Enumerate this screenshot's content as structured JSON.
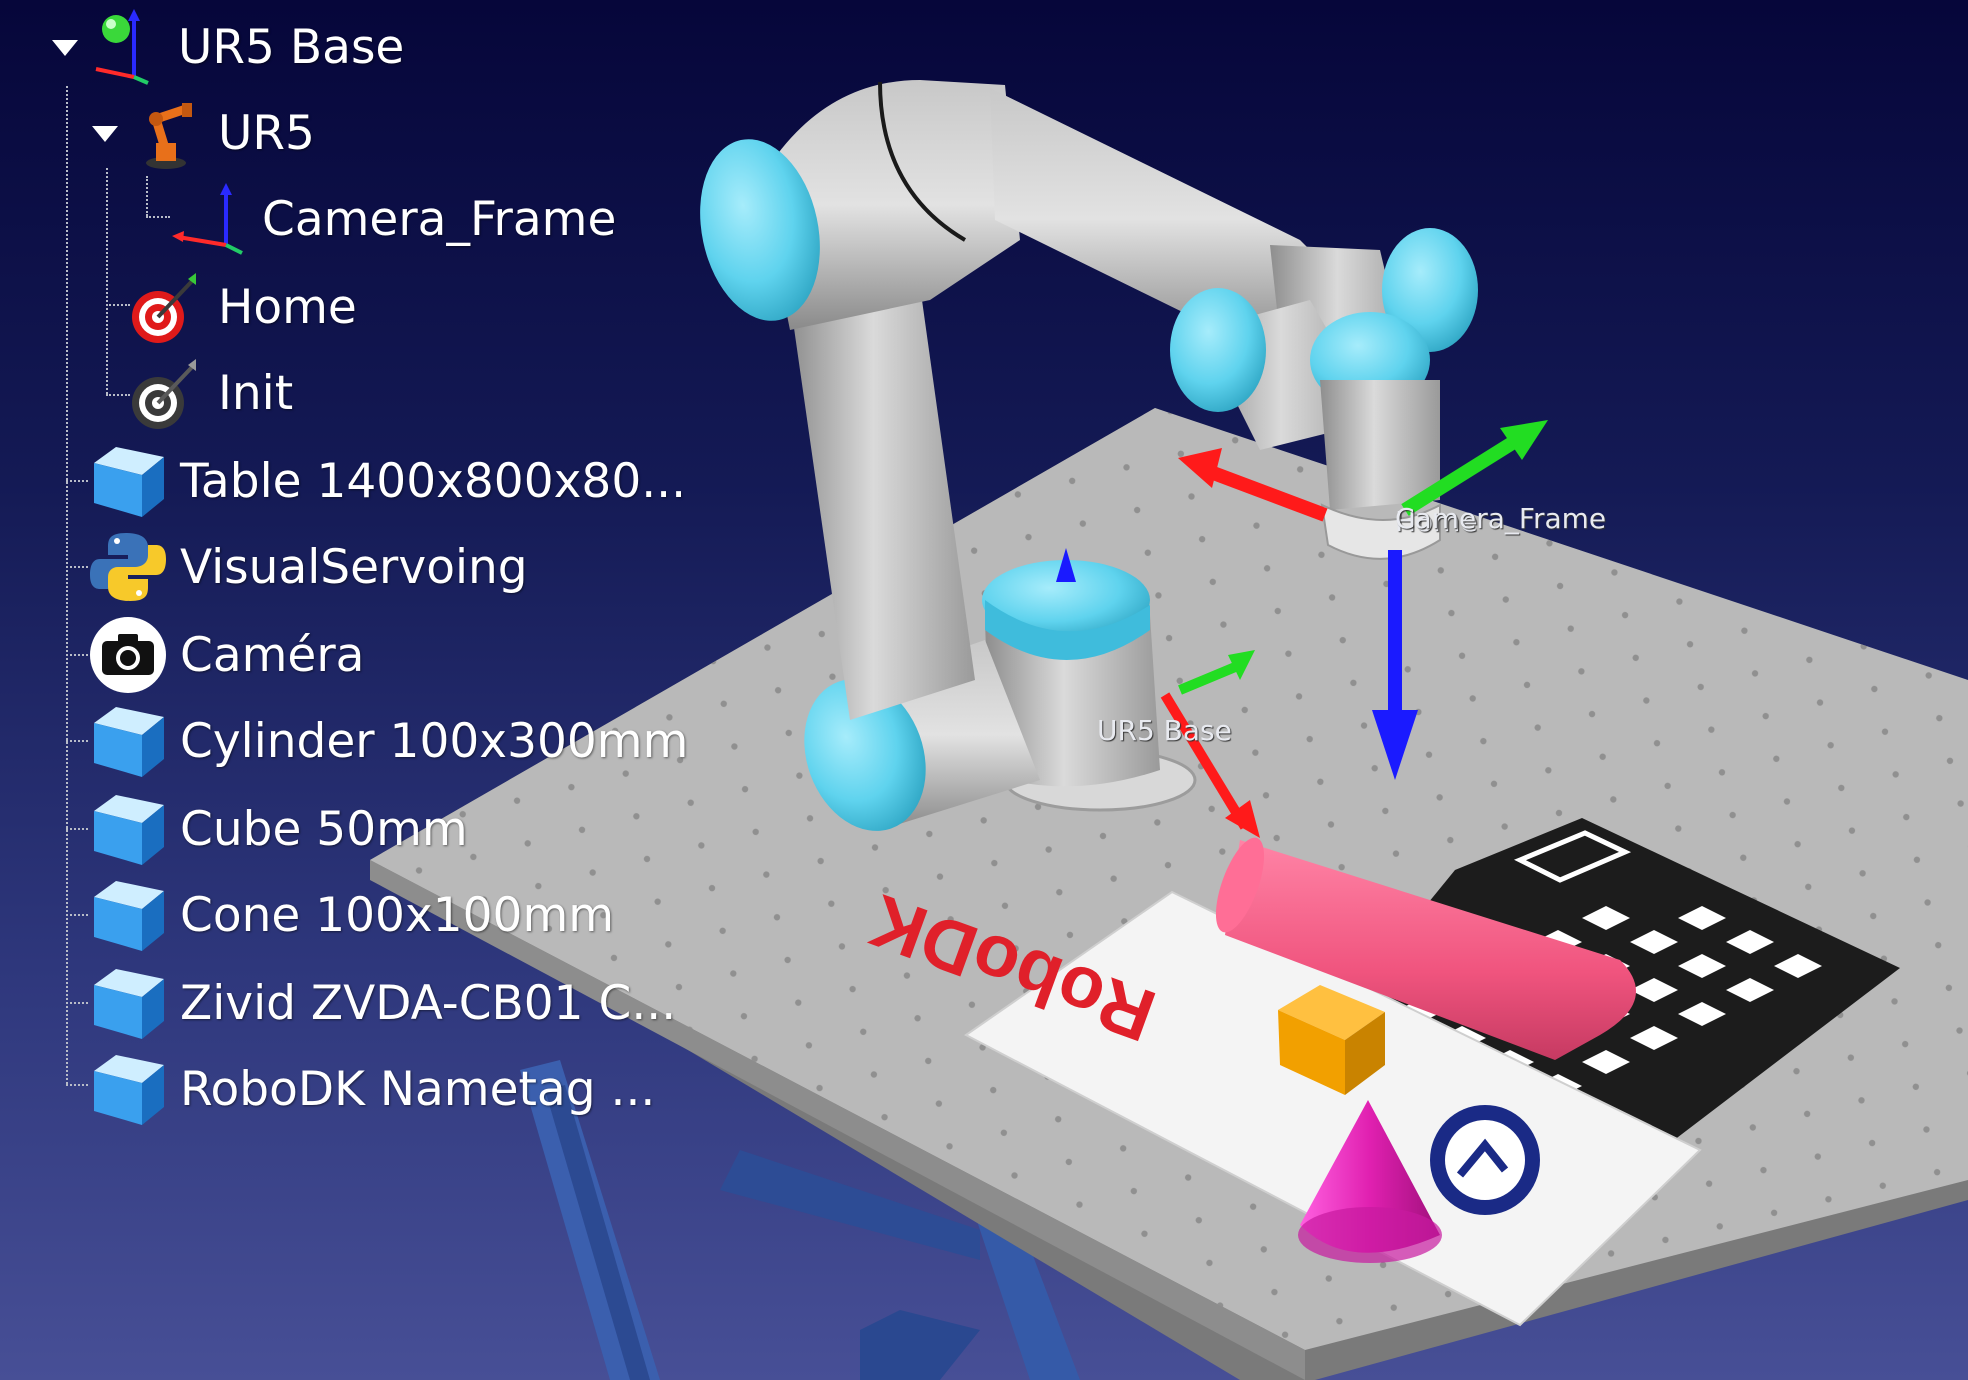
{
  "tree": {
    "root": {
      "label": "UR5 Base",
      "icon": "reference-frame-icon",
      "expanded": true
    },
    "robot": {
      "label": "UR5",
      "icon": "robot-arm-icon",
      "expanded": true
    },
    "items": {
      "camera_frame": {
        "label": "Camera_Frame",
        "icon": "reference-frame-icon"
      },
      "home": {
        "label": "Home",
        "icon": "target-icon"
      },
      "init": {
        "label": "Init",
        "icon": "target-icon"
      },
      "table": {
        "label": "Table 1400x800x80...",
        "icon": "object-cube-icon"
      },
      "visual_servoing": {
        "label": "VisualServoing",
        "icon": "python-icon"
      },
      "camera": {
        "label": "Caméra",
        "icon": "camera-icon"
      },
      "cylinder": {
        "label": "Cylinder 100x300mm",
        "icon": "object-cube-icon"
      },
      "cube": {
        "label": "Cube 50mm",
        "icon": "object-cube-icon"
      },
      "cone": {
        "label": "Cone 100x100mm",
        "icon": "object-cube-icon"
      },
      "zivid": {
        "label": "Zivid ZVDA-CB01 C...",
        "icon": "object-cube-icon"
      },
      "nametag": {
        "label": "RoboDK Nametag ...",
        "icon": "object-cube-icon"
      }
    }
  },
  "viewport": {
    "label_camera_frame": "Camera_Frame",
    "label_home_overlap": "Home",
    "label_ur5_base": "UR5 Base",
    "nametag_text": "RoboDK",
    "axis_colors": {
      "x": "#ff1a1a",
      "y": "#22dd22",
      "z": "#1a1aff"
    },
    "robot_accent": "#5fd3ee",
    "cylinder_color": "#f0547e",
    "cube_color": "#f2a000",
    "cone_color": "#e020b0"
  }
}
